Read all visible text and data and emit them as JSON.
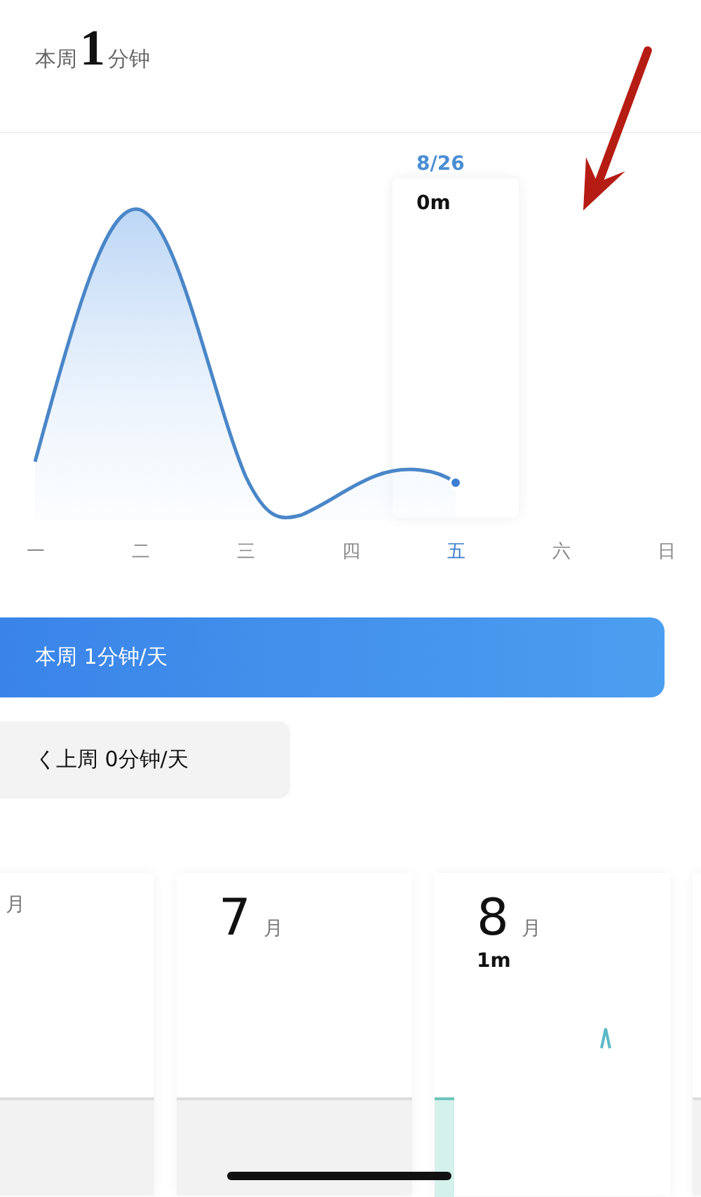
{
  "summary": {
    "prefix": "本周",
    "value": "1",
    "unit": "分钟"
  },
  "chart": {
    "tooltip": {
      "date": "8/26",
      "value": "0m"
    },
    "days": [
      {
        "label": "一",
        "selected": false
      },
      {
        "label": "二",
        "selected": false
      },
      {
        "label": "三",
        "selected": false
      },
      {
        "label": "四",
        "selected": false
      },
      {
        "label": "五",
        "selected": true
      },
      {
        "label": "六",
        "selected": false
      },
      {
        "label": "日",
        "selected": false
      }
    ]
  },
  "this_week": {
    "label": "本周 1分钟/天"
  },
  "last_week": {
    "label": "く上周 0分钟/天"
  },
  "months": [
    {
      "unit": "月",
      "active": false
    },
    {
      "number": "7",
      "unit": "月",
      "active": false
    },
    {
      "number": "8",
      "unit": "月",
      "value": "1m",
      "active": true
    },
    {
      "active": false
    }
  ]
}
